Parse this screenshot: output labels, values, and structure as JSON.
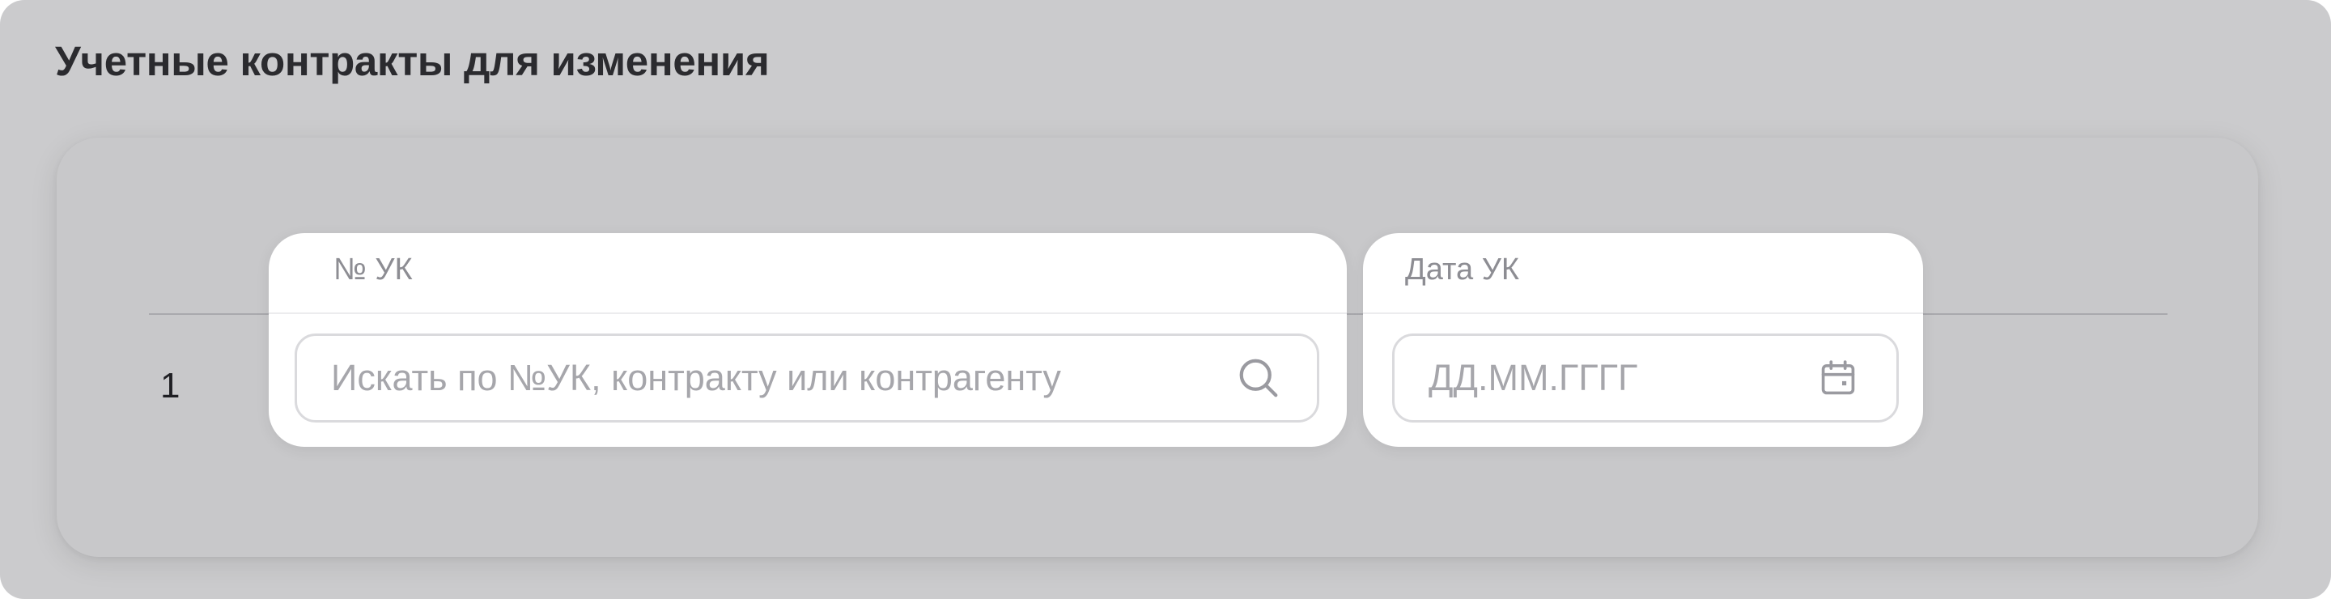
{
  "section": {
    "title": "Учетные контракты для изменения"
  },
  "table": {
    "columns": [
      {
        "key": "contract_number",
        "label": "№ УК"
      },
      {
        "key": "contract_date",
        "label": "Дата УК"
      }
    ],
    "rows": [
      {
        "index": "1",
        "contract_number": {
          "value": "",
          "placeholder": "Искать по №УК, контракту или контрагенту",
          "icon": "search-icon"
        },
        "contract_date": {
          "value": "",
          "placeholder": "ДД.ММ.ГГГГ",
          "icon": "calendar-icon"
        }
      }
    ]
  },
  "colors": {
    "overlay_background": "#cbcbcd",
    "highlight_background": "#ffffff",
    "header_text": "#8d8d93",
    "placeholder_text": "#a6a6ab",
    "icon_stroke": "#9a9aa0"
  }
}
